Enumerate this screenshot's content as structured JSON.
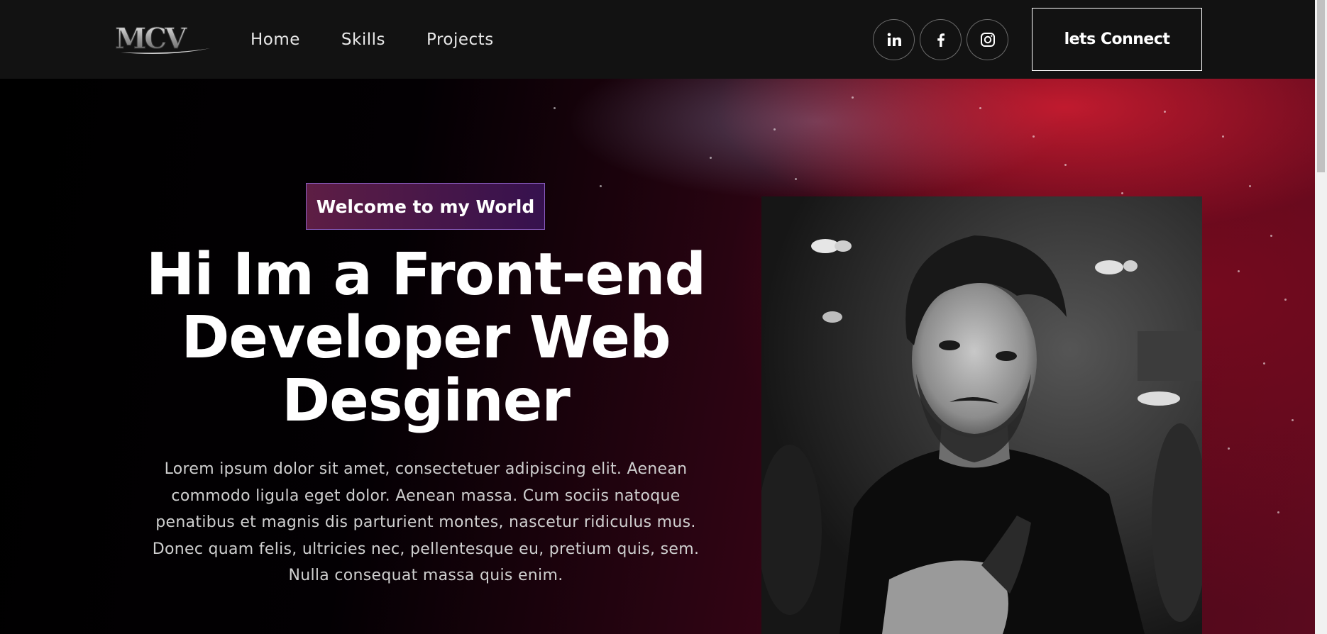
{
  "nav": {
    "logo_text": "MCV",
    "links": [
      "Home",
      "Skills",
      "Projects"
    ],
    "socials": [
      "linkedin-icon",
      "facebook-icon",
      "instagram-icon"
    ],
    "connect_label": "lets Connect"
  },
  "hero": {
    "badge": "Welcome to my World",
    "title_line1": "Hi Im a Front-end",
    "title_line2": "Developer Web",
    "title_line3": "Desginer",
    "description_line1": "Lorem ipsum dolor sit amet, consectetuer adipiscing elit. Aenean",
    "description_line2": "commodo ligula eget dolor. Aenean massa. Cum sociis natoque",
    "description_line3": "penatibus et magnis dis parturient montes, nascetur ridiculus mus.",
    "description_line4": "Donec quam felis, ultricies nec, pellentesque eu, pretium quis, sem.",
    "description_line5": "Nulla consequat massa quis enim.",
    "portrait_description": "black-and-white portrait photo"
  },
  "colors": {
    "navbar_bg": "#121212",
    "hero_accent": "#c81e32",
    "badge_border": "#8a5dc0"
  }
}
